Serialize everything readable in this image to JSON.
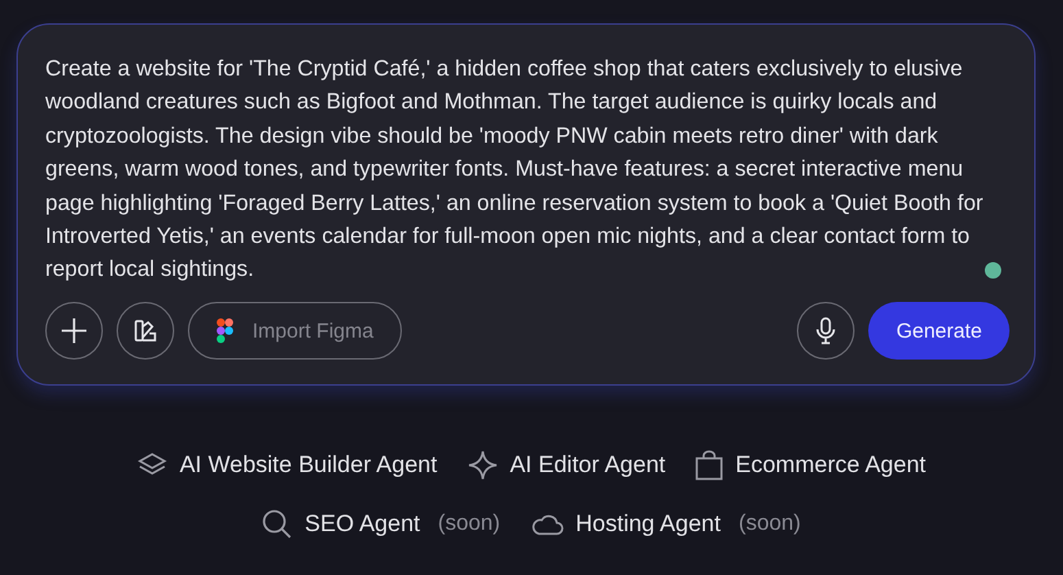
{
  "prompt": {
    "text": "Create a website for 'The Cryptid Café,' a hidden coffee shop that caters exclusively to elusive woodland creatures such as Bigfoot and Mothman. The target audience is quirky locals and cryptozoologists. The design vibe should be 'moody PNW cabin meets retro diner' with dark greens, warm wood tones, and typewriter fonts. Must-have features: a secret interactive menu page highlighting 'Foraged Berry Lattes,' an online reservation system to book a 'Quiet Booth for Introverted Yetis,' an events calendar for full-moon open mic nights, and a clear contact form to report local sightings."
  },
  "import_button": "Import Figma",
  "generate_button": "Generate",
  "agent_rows": [
    [
      {
        "label": "AI Website Builder Agent"
      },
      {
        "label": "AI Editor Agent"
      },
      {
        "label": "Ecommerce Agent"
      }
    ],
    [
      {
        "label": "SEO Agent",
        "badge": "(soon)"
      },
      {
        "label": "Hosting Agent",
        "badge": "(soon)"
      }
    ]
  ]
}
